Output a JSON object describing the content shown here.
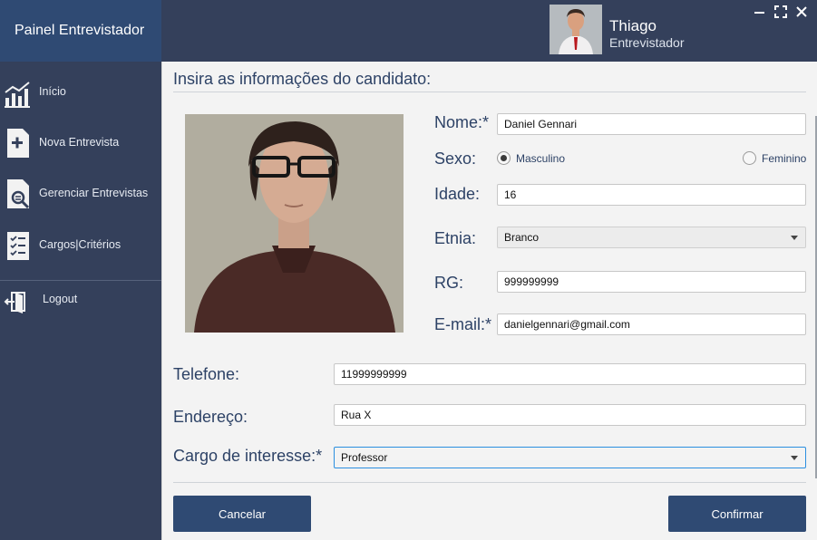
{
  "app": {
    "brand": "Painel Entrevistador"
  },
  "user": {
    "name": "Thiago",
    "role": "Entrevistador"
  },
  "window": {
    "minimize": "−",
    "maximize": "⛶",
    "close": "✕"
  },
  "sidebar": {
    "items": [
      {
        "label": "Início",
        "icon": "chart-icon"
      },
      {
        "label": "Nova Entrevista",
        "icon": "add-document-icon"
      },
      {
        "label": "Gerenciar Entrevistas",
        "icon": "search-document-icon"
      },
      {
        "label": "Cargos|Critérios",
        "icon": "checklist-icon"
      },
      {
        "label": "Logout",
        "icon": "logout-icon"
      }
    ]
  },
  "form": {
    "heading": "Insira as informações do candidato:",
    "nome": {
      "label": "Nome:*",
      "value": "Daniel Gennari"
    },
    "sexo": {
      "label": "Sexo:",
      "options": [
        "Masculino",
        "Feminino"
      ],
      "selected": "Masculino"
    },
    "idade": {
      "label": "Idade:",
      "value": "16"
    },
    "etnia": {
      "label": "Etnia:",
      "value": "Branco"
    },
    "rg": {
      "label": "RG:",
      "value": "999999999"
    },
    "email": {
      "label": "E-mail:*",
      "value": "danielgennari@gmail.com"
    },
    "telefone": {
      "label": "Telefone:",
      "value": "11999999999"
    },
    "endereco": {
      "label": "Endereço:",
      "value": "Rua X"
    },
    "cargo": {
      "label": "Cargo de interesse:*",
      "value": "Professor"
    }
  },
  "actions": {
    "cancel": "Cancelar",
    "confirm": "Confirmar"
  },
  "colors": {
    "primary": "#2f4a73",
    "sidebar": "#34405b",
    "focus": "#2b8fe0"
  }
}
